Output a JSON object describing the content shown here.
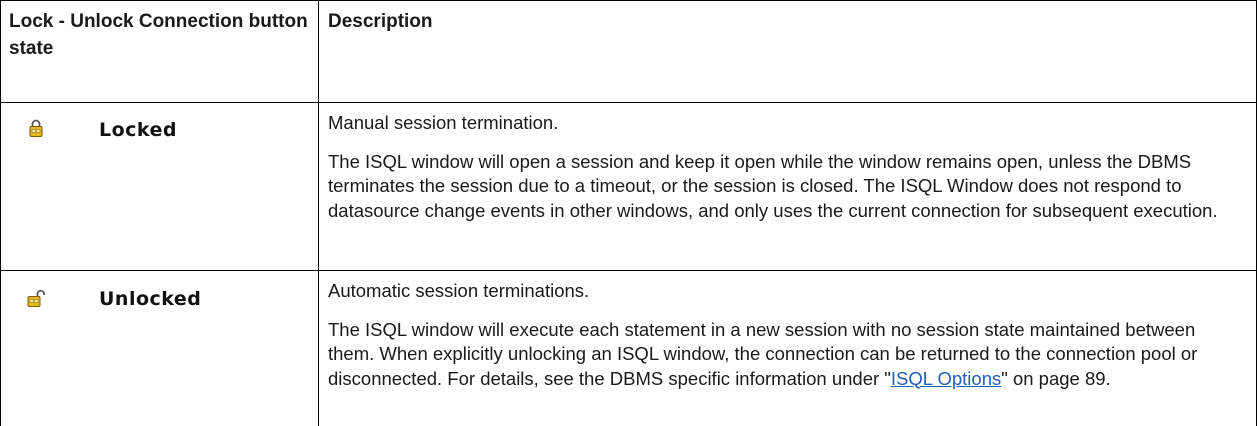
{
  "header": {
    "col1_label": "Lock - Unlock Connection button state",
    "col2_label": "Description"
  },
  "rows": [
    {
      "state_icon": "padlock-closed-icon",
      "state_label": "Locked",
      "summary": "Manual session termination.",
      "detail": "The ISQL window will open a session and keep it open while the window remains open, unless the DBMS terminates the session due to a timeout, or the session is closed. The ISQL Window does not respond to datasource change events in other windows, and only uses the current connection for subsequent execution."
    },
    {
      "state_icon": "padlock-open-icon",
      "state_label": "Unlocked",
      "summary": "Automatic session terminations.",
      "detail_before_link": "The ISQL window will execute each statement in a new session with no session state maintained between them. When explicitly unlocking an ISQL window, the connection can be returned to the connection pool or disconnected. For details, see the DBMS specific information under \"",
      "link_text": "ISQL Options",
      "detail_after_link": "\" on page 89."
    }
  ],
  "colors": {
    "grid": "#000000",
    "text": "#1a1a1a",
    "link": "#1f5fbf",
    "icon_lock": "#d9a400"
  }
}
